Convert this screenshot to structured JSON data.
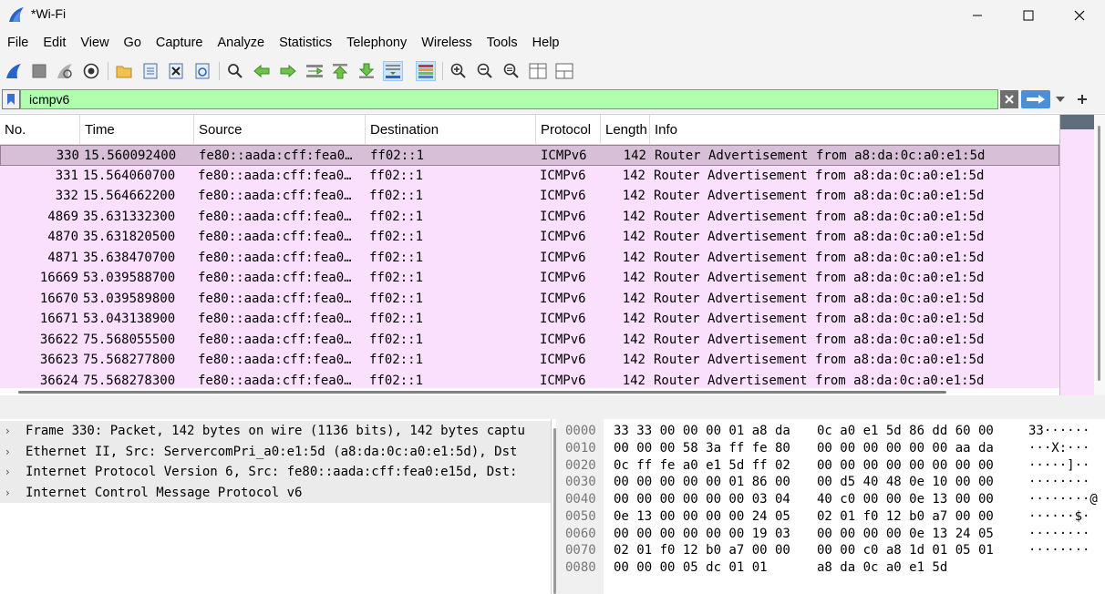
{
  "window": {
    "title": "*Wi-Fi",
    "accent_color": "#3b6fd1"
  },
  "menu": [
    "File",
    "Edit",
    "View",
    "Go",
    "Capture",
    "Analyze",
    "Statistics",
    "Telephony",
    "Wireless",
    "Tools",
    "Help"
  ],
  "toolbar": {
    "icons": [
      "start-capture-icon",
      "stop-capture-icon",
      "restart-capture-icon",
      "capture-options-icon",
      "open-file-icon",
      "save-file-icon",
      "close-file-icon",
      "reload-file-icon",
      "find-packet-icon",
      "go-back-icon",
      "go-forward-icon",
      "go-to-packet-icon",
      "go-first-icon",
      "go-last-icon",
      "autoscroll-icon",
      "colorize-icon",
      "zoom-in-icon",
      "zoom-out-icon",
      "normal-size-icon",
      "resize-columns-icon",
      "layout-icon"
    ]
  },
  "filter": {
    "value": "icmpv6",
    "background": "#afffaf"
  },
  "packet_list": {
    "columns": [
      "No.",
      "Time",
      "Source",
      "Destination",
      "Protocol",
      "Length",
      "Info"
    ],
    "rows": [
      {
        "no": "330",
        "time": "15.560092400",
        "src": "fe80::aada:cff:fea0…",
        "dst": "ff02::1",
        "proto": "ICMPv6",
        "len": "142",
        "info": "Router Advertisement from a8:da:0c:a0:e1:5d"
      },
      {
        "no": "331",
        "time": "15.564060700",
        "src": "fe80::aada:cff:fea0…",
        "dst": "ff02::1",
        "proto": "ICMPv6",
        "len": "142",
        "info": "Router Advertisement from a8:da:0c:a0:e1:5d"
      },
      {
        "no": "332",
        "time": "15.564662200",
        "src": "fe80::aada:cff:fea0…",
        "dst": "ff02::1",
        "proto": "ICMPv6",
        "len": "142",
        "info": "Router Advertisement from a8:da:0c:a0:e1:5d"
      },
      {
        "no": "4869",
        "time": "35.631332300",
        "src": "fe80::aada:cff:fea0…",
        "dst": "ff02::1",
        "proto": "ICMPv6",
        "len": "142",
        "info": "Router Advertisement from a8:da:0c:a0:e1:5d"
      },
      {
        "no": "4870",
        "time": "35.631820500",
        "src": "fe80::aada:cff:fea0…",
        "dst": "ff02::1",
        "proto": "ICMPv6",
        "len": "142",
        "info": "Router Advertisement from a8:da:0c:a0:e1:5d"
      },
      {
        "no": "4871",
        "time": "35.638470700",
        "src": "fe80::aada:cff:fea0…",
        "dst": "ff02::1",
        "proto": "ICMPv6",
        "len": "142",
        "info": "Router Advertisement from a8:da:0c:a0:e1:5d"
      },
      {
        "no": "16669",
        "time": "53.039588700",
        "src": "fe80::aada:cff:fea0…",
        "dst": "ff02::1",
        "proto": "ICMPv6",
        "len": "142",
        "info": "Router Advertisement from a8:da:0c:a0:e1:5d"
      },
      {
        "no": "16670",
        "time": "53.039589800",
        "src": "fe80::aada:cff:fea0…",
        "dst": "ff02::1",
        "proto": "ICMPv6",
        "len": "142",
        "info": "Router Advertisement from a8:da:0c:a0:e1:5d"
      },
      {
        "no": "16671",
        "time": "53.043138900",
        "src": "fe80::aada:cff:fea0…",
        "dst": "ff02::1",
        "proto": "ICMPv6",
        "len": "142",
        "info": "Router Advertisement from a8:da:0c:a0:e1:5d"
      },
      {
        "no": "36622",
        "time": "75.568055500",
        "src": "fe80::aada:cff:fea0…",
        "dst": "ff02::1",
        "proto": "ICMPv6",
        "len": "142",
        "info": "Router Advertisement from a8:da:0c:a0:e1:5d"
      },
      {
        "no": "36623",
        "time": "75.568277800",
        "src": "fe80::aada:cff:fea0…",
        "dst": "ff02::1",
        "proto": "ICMPv6",
        "len": "142",
        "info": "Router Advertisement from a8:da:0c:a0:e1:5d"
      },
      {
        "no": "36624",
        "time": "75.568278300",
        "src": "fe80::aada:cff:fea0…",
        "dst": "ff02::1",
        "proto": "ICMPv6",
        "len": "142",
        "info": "Router Advertisement from a8:da:0c:a0:e1:5d"
      }
    ],
    "row_color": "#fae0fd",
    "selected_color": "#d8bfd8"
  },
  "details": [
    "Frame 330: Packet, 142 bytes on wire (1136 bits), 142 bytes captu",
    "Ethernet II, Src: ServercomPri_a0:e1:5d (a8:da:0c:a0:e1:5d), Dst",
    "Internet Protocol Version 6, Src: fe80::aada:cff:fea0:e15d, Dst:",
    "Internet Control Message Protocol v6"
  ],
  "bytes": [
    {
      "off": "0000",
      "hex1": "33 33 00 00 00 01 a8 da",
      "hex2": "0c a0 e1 5d 86 dd 60 00",
      "ascii": "33······"
    },
    {
      "off": "0010",
      "hex1": "00 00 00 58 3a ff fe 80",
      "hex2": "00 00 00 00 00 00 aa da",
      "ascii": "···X:···"
    },
    {
      "off": "0020",
      "hex1": "0c ff fe a0 e1 5d ff 02",
      "hex2": "00 00 00 00 00 00 00 00",
      "ascii": "·····]··"
    },
    {
      "off": "0030",
      "hex1": "00 00 00 00 00 01 86 00",
      "hex2": "00 d5 40 48 0e 10 00 00",
      "ascii": "········"
    },
    {
      "off": "0040",
      "hex1": "00 00 00 00 00 00 03 04",
      "hex2": "40 c0 00 00 0e 13 00 00",
      "ascii": "········@"
    },
    {
      "off": "0050",
      "hex1": "0e 13 00 00 00 00 24 05",
      "hex2": "02 01 f0 12 b0 a7 00 00",
      "ascii": "······$·"
    },
    {
      "off": "0060",
      "hex1": "00 00 00 00 00 00 19 03",
      "hex2": "00 00 00 00 0e 13 24 05",
      "ascii": "········"
    },
    {
      "off": "0070",
      "hex1": "02 01 f0 12 b0 a7 00 00",
      "hex2": "00 00 c0 a8 1d 01 05 01",
      "ascii": "········"
    },
    {
      "off": "0080",
      "hex1": "00 00 00 05 dc 01 01",
      "hex2": "a8 da 0c a0 e1 5d",
      "ascii": ""
    }
  ]
}
